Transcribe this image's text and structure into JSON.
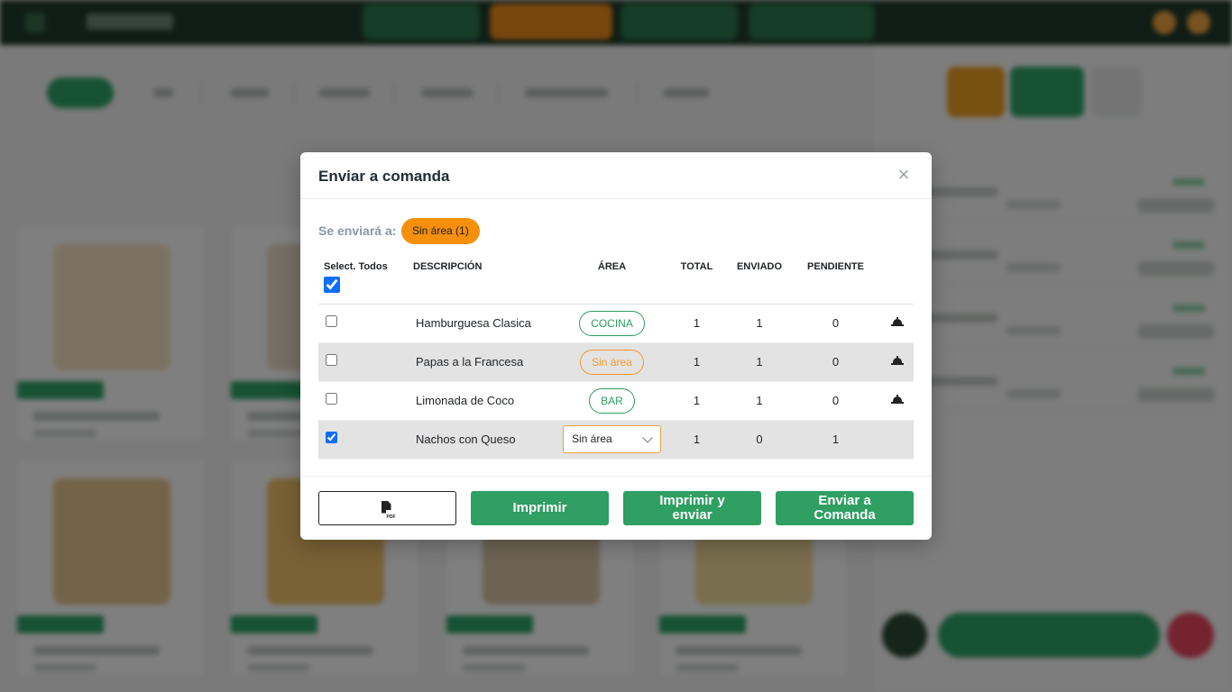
{
  "modal": {
    "title": "Enviar a comanda",
    "close_glyph": "×",
    "send_to_label": "Se enviará a:",
    "send_to_badge": "Sin área (1)",
    "columns": {
      "select_all": "Select. Todos",
      "description": "DESCRIPCIÓN",
      "area": "ÁREA",
      "total": "TOTAL",
      "sent": "ENVIADO",
      "pending": "PENDIENTE"
    },
    "select_all_checked": true,
    "rows": [
      {
        "checked": false,
        "description": "Hamburguesa Clasica",
        "area": "COCINA",
        "area_style": "green",
        "total": "1",
        "sent": "1",
        "pending": "0",
        "icon": "bell-icon"
      },
      {
        "checked": false,
        "description": "Papas a la Francesa",
        "area": "Sin área",
        "area_style": "orange",
        "total": "1",
        "sent": "1",
        "pending": "0",
        "icon": "bell-icon"
      },
      {
        "checked": false,
        "description": "Limonada de Coco",
        "area": "BAR",
        "area_style": "green",
        "total": "1",
        "sent": "1",
        "pending": "0",
        "icon": "bell-icon"
      },
      {
        "checked": true,
        "description": "Nachos con Queso",
        "area": "Sin área",
        "area_style": "select",
        "total": "1",
        "sent": "0",
        "pending": "1",
        "icon": ""
      }
    ],
    "footer": {
      "pdf_button_icon": "pdf-icon",
      "pdf_icon_text": "PDF",
      "print_label": "Imprimir",
      "print_send_label": "Imprimir y enviar",
      "send_label": "Enviar a Comanda"
    }
  },
  "colors": {
    "primary_green": "#2f9f62",
    "accent_orange": "#f58f0c",
    "overlay": "rgba(0,0,0,0.5)"
  }
}
